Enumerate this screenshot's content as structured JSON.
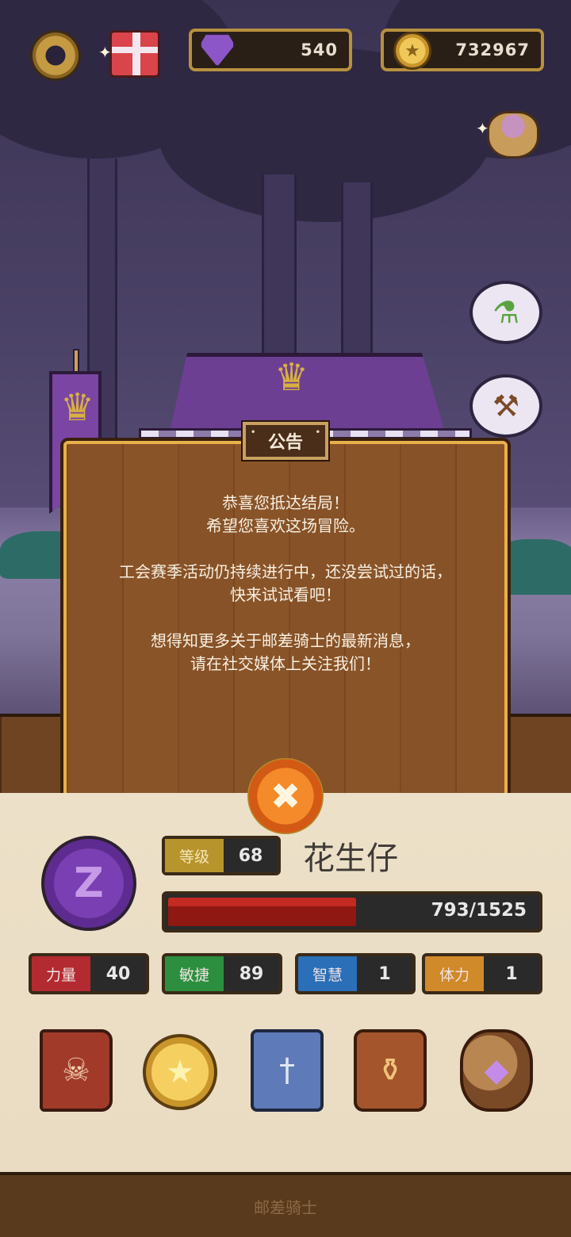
{
  "hud": {
    "gems": "540",
    "coins": "732967"
  },
  "announcement": {
    "title": "公告",
    "lines": [
      "恭喜您抵达结局！",
      "希望您喜欢这场冒险。",
      "",
      "工会赛季活动仍持续进行中，还没尝试过的话，",
      "快来试试看吧！",
      "",
      "想得知更多关于邮差骑士的最新消息，",
      "请在社交媒体上关注我们！"
    ]
  },
  "player": {
    "level_label": "等级",
    "level": "68",
    "name": "花生仔",
    "hp_text": "793/1525",
    "hp_fraction": 0.52
  },
  "stats": [
    {
      "label": "力量",
      "value": "40"
    },
    {
      "label": "敏捷",
      "value": "89"
    },
    {
      "label": "智慧",
      "value": "1"
    },
    {
      "label": "体力",
      "value": "1"
    }
  ],
  "menu_icons": [
    "spellbook-icon",
    "star-coin-icon",
    "card-deck-icon",
    "backpack-icon",
    "loot-bag-icon"
  ],
  "footer": {
    "title": "邮差骑士"
  }
}
